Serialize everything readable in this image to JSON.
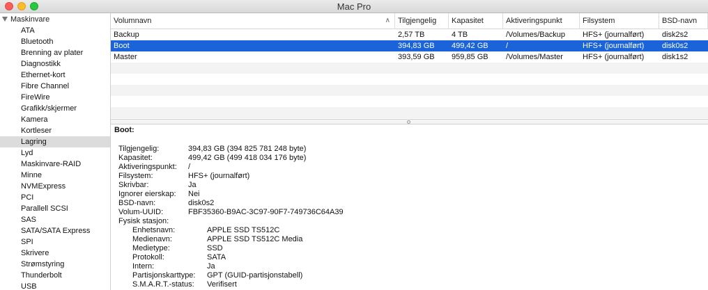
{
  "window": {
    "title": "Mac Pro"
  },
  "sidebar": {
    "header": "Maskinvare",
    "selected_index": 11,
    "items": [
      "ATA",
      "Bluetooth",
      "Brenning av plater",
      "Diagnostikk",
      "Ethernet-kort",
      "Fibre Channel",
      "FireWire",
      "Grafikk/skjermer",
      "Kamera",
      "Kortleser",
      "Lagring",
      "Lyd",
      "Maskinvare-RAID",
      "Minne",
      "NVMExpress",
      "PCI",
      "Parallell SCSI",
      "SAS",
      "SATA/SATA Express",
      "SPI",
      "Skrivere",
      "Strømstyring",
      "Thunderbolt",
      "USB"
    ]
  },
  "table": {
    "columns": [
      "Volumnavn",
      "Tilgjengelig",
      "Kapasitet",
      "Aktiveringspunkt",
      "Filsystem",
      "BSD-navn"
    ],
    "rows": [
      [
        "Backup",
        "2,57 TB",
        "4 TB",
        "/Volumes/Backup",
        "HFS+ (journalført)",
        "disk2s2"
      ],
      [
        "Boot",
        "394,83 GB",
        "499,42 GB",
        "/",
        "HFS+ (journalført)",
        "disk0s2"
      ],
      [
        "Master",
        "393,59 GB",
        "959,85 GB",
        "/Volumes/Master",
        "HFS+ (journalført)",
        "disk1s2"
      ]
    ],
    "selected_row": 1
  },
  "detail": {
    "title": "Boot:",
    "fields": [
      {
        "k": "Tilgjengelig:",
        "v": "394,83 GB (394 825 781 248 byte)",
        "sub": false
      },
      {
        "k": "Kapasitet:",
        "v": "499,42 GB (499 418 034 176 byte)",
        "sub": false
      },
      {
        "k": "Aktiveringspunkt:",
        "v": "/",
        "sub": false
      },
      {
        "k": "Filsystem:",
        "v": "HFS+ (journalført)",
        "sub": false
      },
      {
        "k": "Skrivbar:",
        "v": "Ja",
        "sub": false
      },
      {
        "k": "Ignorer eierskap:",
        "v": "Nei",
        "sub": false
      },
      {
        "k": "BSD-navn:",
        "v": "disk0s2",
        "sub": false
      },
      {
        "k": "Volum-UUID:",
        "v": "FBF35360-B9AC-3C97-90F7-749736C64A39",
        "sub": false
      },
      {
        "k": "Fysisk stasjon:",
        "v": "",
        "sub": false
      },
      {
        "k": "Enhetsnavn:",
        "v": "APPLE SSD TS512C",
        "sub": true
      },
      {
        "k": "Medienavn:",
        "v": "APPLE SSD TS512C Media",
        "sub": true
      },
      {
        "k": "Medietype:",
        "v": "SSD",
        "sub": true
      },
      {
        "k": "Protokoll:",
        "v": "SATA",
        "sub": true
      },
      {
        "k": "Intern:",
        "v": "Ja",
        "sub": true
      },
      {
        "k": "Partisjonskarttype:",
        "v": "GPT (GUID-partisjonstabell)",
        "sub": true
      },
      {
        "k": "S.M.A.R.T.-status:",
        "v": "Verifisert",
        "sub": true
      }
    ]
  }
}
